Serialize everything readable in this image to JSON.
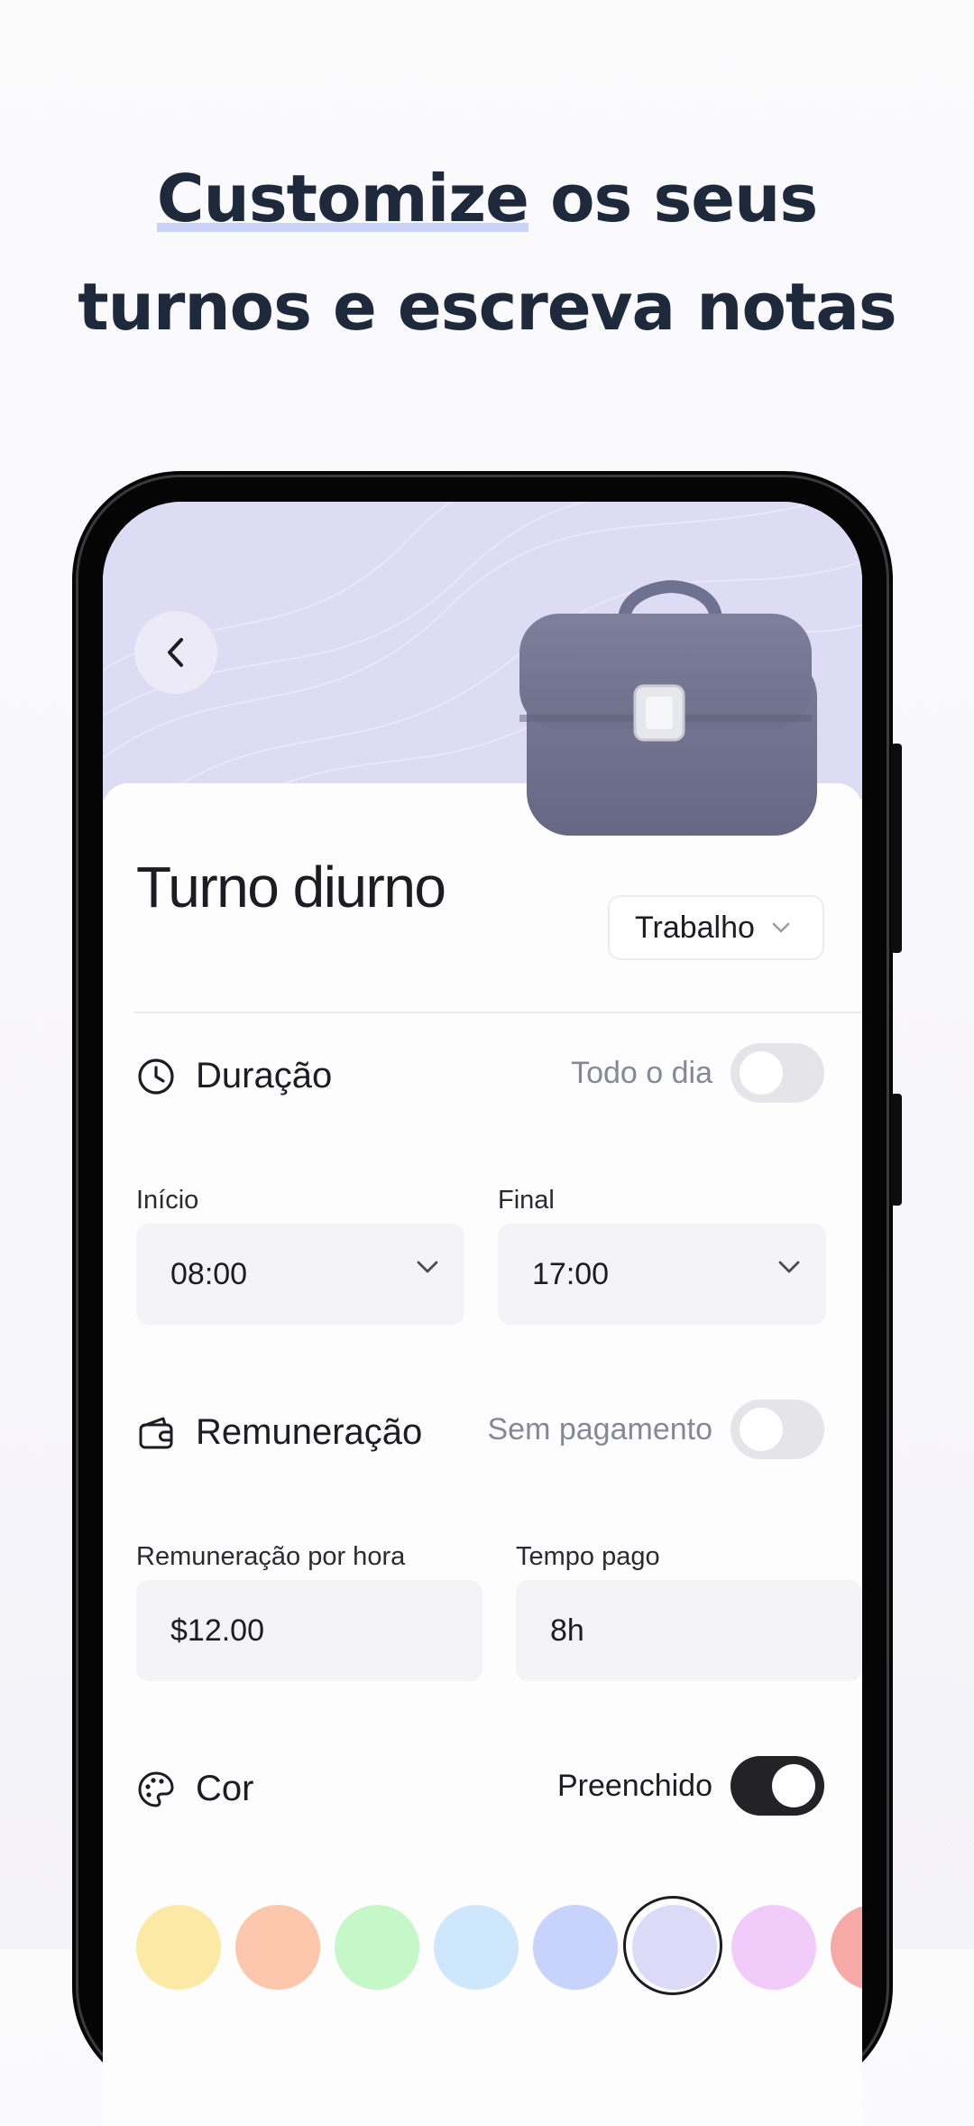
{
  "headline": {
    "line1_highlight": "Customize",
    "line1_rest": " os seus",
    "line2": "turnos e escreva notas"
  },
  "shift": {
    "title": "Turno diurno",
    "category": "Trabalho"
  },
  "duration": {
    "label": "Duração",
    "toggle_label": "Todo o dia",
    "all_day": false,
    "start_label": "Início",
    "start_value": "08:00",
    "end_label": "Final",
    "end_value": "17:00"
  },
  "pay": {
    "label": "Remuneração",
    "toggle_label": "Sem pagamento",
    "no_pay": false,
    "rate_label": "Remuneração por hora",
    "rate_value": "$12.00",
    "paid_time_label": "Tempo pago",
    "paid_time_value": "8h"
  },
  "color": {
    "label": "Cor",
    "toggle_label": "Preenchido",
    "filled": true,
    "swatches": [
      "#fde9a6",
      "#fdc7ad",
      "#c5f7c8",
      "#cfe7fd",
      "#c7d3fb",
      "#dcdaf7",
      "#f1cbfa",
      "#f6a9a6"
    ],
    "selected_index": 5
  },
  "icons": [
    "back-arrow-icon",
    "briefcase-icon",
    "chevron-down-icon",
    "clock-icon",
    "wallet-icon",
    "palette-icon"
  ],
  "colors": {
    "hero_bg": "#dedbf4",
    "text_dark": "#1c1c22",
    "muted": "#878896",
    "highlight": "#c9d3f7"
  }
}
